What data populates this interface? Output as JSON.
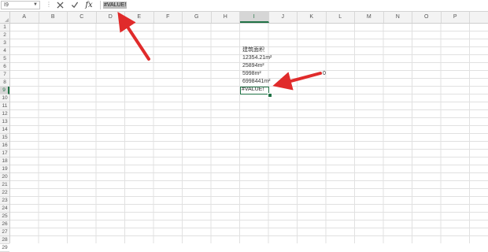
{
  "formula_bar": {
    "name_box": "I9",
    "dots": "⋮",
    "cancel_icon": "close-icon",
    "enter_icon": "check-icon",
    "function_label": "fx",
    "formula_value": "#VALUE!"
  },
  "columns": [
    "A",
    "B",
    "C",
    "D",
    "E",
    "F",
    "G",
    "H",
    "I",
    "J",
    "K",
    "L",
    "M",
    "N",
    "O",
    "P"
  ],
  "active_column": "I",
  "rows": [
    "1",
    "2",
    "3",
    "4",
    "5",
    "6",
    "7",
    "8",
    "9",
    "10",
    "11",
    "12",
    "13",
    "14",
    "15",
    "16",
    "17",
    "18",
    "19",
    "20",
    "21",
    "22",
    "23",
    "24",
    "25",
    "26",
    "27",
    "28",
    "29"
  ],
  "active_row": "9",
  "cells": {
    "I4": "建筑面积",
    "I5": "12354.21m²",
    "I6": "25894m²",
    "I7": "5998m²",
    "I8": "6998441m²",
    "I9": "#VALUE!",
    "K7": "0"
  },
  "colors": {
    "selection": "#217346",
    "arrow": "#e02b2b"
  }
}
